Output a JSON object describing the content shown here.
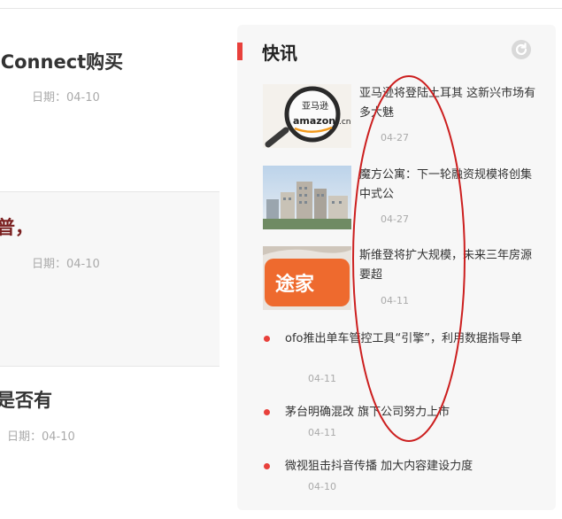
{
  "left_articles": [
    {
      "title": "-Connect购买",
      "date": "日期：04-10"
    },
    {
      "title": "普，",
      "date": "日期：04-10"
    },
    {
      "title": "是否有",
      "date": "日期：04-10"
    }
  ],
  "news_panel": {
    "title": "快讯",
    "image_items": [
      {
        "title": "亚马逊将登陆土耳其 这新兴市场有多大魅",
        "date": "04-27",
        "image_icon": "amazon-magnifier-image",
        "image_text": "亚马逊 amazon.cn"
      },
      {
        "title": "魔方公寓：下一轮融资规模将创集中式公",
        "date": "04-27",
        "image_icon": "apartment-buildings-image"
      },
      {
        "title": "斯维登将扩大规模，未来三年房源要超",
        "date": "04-11",
        "image_icon": "tujia-logo-image",
        "image_text": "途家"
      }
    ],
    "text_items": [
      {
        "title": "ofo推出单车管控工具“引擎”，利用数据指导单",
        "date": "04-11"
      },
      {
        "title": "茅台明确混改 旗下公司努力上市",
        "date": "04-11"
      },
      {
        "title": "微视狙击抖音传播 加大内容建设力度",
        "date": "04-10"
      }
    ]
  },
  "colors": {
    "accent": "#e8403b",
    "annotation": "#cc1f1f"
  }
}
